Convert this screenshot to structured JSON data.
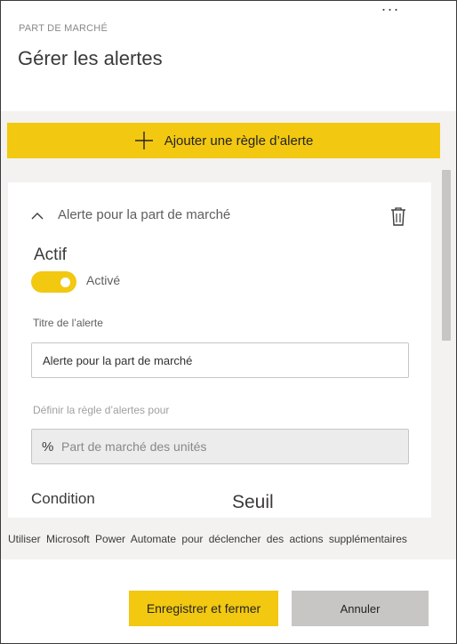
{
  "header": {
    "more_label": "···",
    "subtitle": "PART DE MARCHÉ",
    "title": "Gérer les alertes"
  },
  "add_rule": {
    "label": "Ajouter une règle d’alerte",
    "icon": "plus-icon"
  },
  "rule_card": {
    "name": "Alerte pour la part de marché",
    "expanded": true,
    "active_heading": "Actif",
    "toggle_state_label": "Activé",
    "toggle_on": true,
    "title_field_label": "Titre de l’alerte",
    "title_field_value": "Alerte pour la part de marché",
    "rule_for_label": "Définir la règle d’alertes pour",
    "measure_prefix": "%",
    "measure_value": "Part de marché des unités",
    "condition_label": "Condition",
    "threshold_label": "Seuil"
  },
  "power_automate_link": "Utiliser Microsoft Power Automate pour déclencher des actions supplémentaires",
  "footer": {
    "save_label": "Enregistrer et fermer",
    "cancel_label": "Annuler"
  },
  "colors": {
    "accent": "#f2c811",
    "panel_gray": "#f3f2f1",
    "cancel_gray": "#c8c6c4"
  }
}
